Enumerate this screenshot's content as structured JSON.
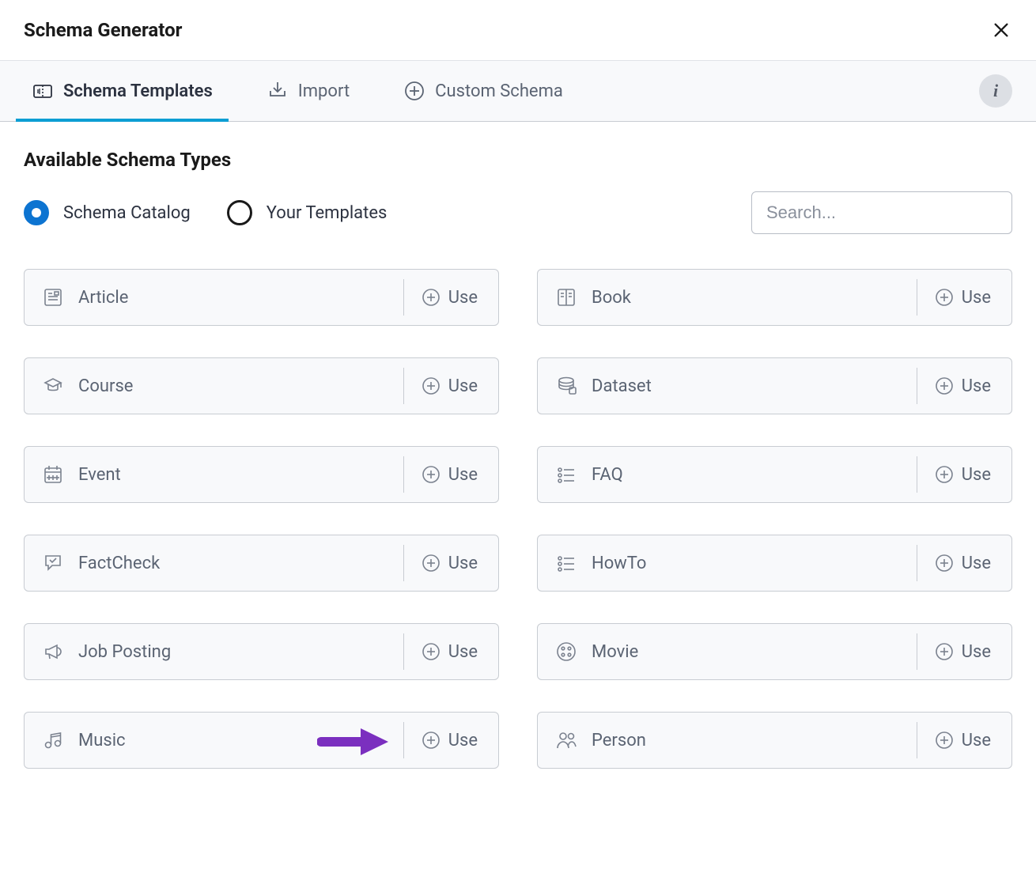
{
  "header": {
    "title": "Schema Generator"
  },
  "tabs": [
    {
      "id": "templates",
      "label": "Schema Templates",
      "active": true
    },
    {
      "id": "import",
      "label": "Import",
      "active": false
    },
    {
      "id": "custom",
      "label": "Custom Schema",
      "active": false
    }
  ],
  "section": {
    "title": "Available Schema Types"
  },
  "filters": {
    "radios": [
      {
        "id": "catalog",
        "label": "Schema Catalog",
        "selected": true
      },
      {
        "id": "your",
        "label": "Your Templates",
        "selected": false
      }
    ],
    "search_placeholder": "Search...",
    "search_value": ""
  },
  "use_label": "Use",
  "schemas": [
    {
      "id": "article",
      "label": "Article",
      "icon": "article-icon"
    },
    {
      "id": "book",
      "label": "Book",
      "icon": "book-icon"
    },
    {
      "id": "course",
      "label": "Course",
      "icon": "course-icon"
    },
    {
      "id": "dataset",
      "label": "Dataset",
      "icon": "dataset-icon"
    },
    {
      "id": "event",
      "label": "Event",
      "icon": "event-icon"
    },
    {
      "id": "faq",
      "label": "FAQ",
      "icon": "list-icon"
    },
    {
      "id": "factcheck",
      "label": "FactCheck",
      "icon": "factcheck-icon"
    },
    {
      "id": "howto",
      "label": "HowTo",
      "icon": "list-icon"
    },
    {
      "id": "jobposting",
      "label": "Job Posting",
      "icon": "megaphone-icon"
    },
    {
      "id": "movie",
      "label": "Movie",
      "icon": "movie-icon"
    },
    {
      "id": "music",
      "label": "Music",
      "icon": "music-icon",
      "highlighted": true
    },
    {
      "id": "person",
      "label": "Person",
      "icon": "person-icon"
    }
  ],
  "annotation": {
    "target": "music",
    "color": "#7b2fbf"
  }
}
